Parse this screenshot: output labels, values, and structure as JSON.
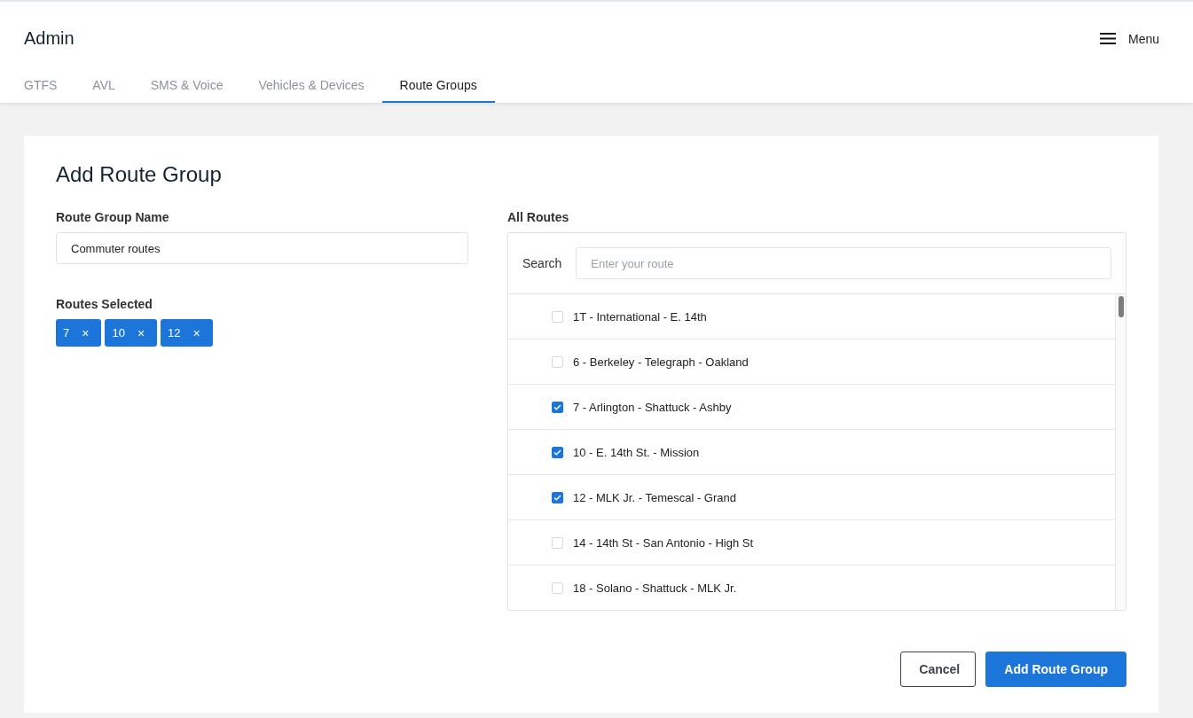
{
  "header": {
    "title": "Admin",
    "menu": {
      "label": "Menu"
    }
  },
  "tabs": [
    {
      "label": "GTFS",
      "selected": false
    },
    {
      "label": "AVL",
      "selected": false
    },
    {
      "label": "SMS & Voice",
      "selected": false
    },
    {
      "label": "Vehicles & Devices",
      "selected": false
    },
    {
      "label": "Route Groups",
      "selected": true
    }
  ],
  "form": {
    "title": "Add Route Group",
    "name_field": {
      "label": "Route Group Name",
      "value": "Commuter routes"
    },
    "selected_routes": {
      "label": "Routes Selected",
      "chips": [
        {
          "label": "7",
          "remove": "×"
        },
        {
          "label": "10",
          "remove": "×"
        },
        {
          "label": "12",
          "remove": "×"
        }
      ]
    },
    "all_routes": {
      "label": "All Routes",
      "search": {
        "label": "Search",
        "placeholder": "Enter your route"
      },
      "routes": [
        {
          "label": "1T - International - E. 14th",
          "checked": false
        },
        {
          "label": "6 - Berkeley - Telegraph - Oakland",
          "checked": false
        },
        {
          "label": "7 - Arlington - Shattuck - Ashby",
          "checked": true
        },
        {
          "label": "10 - E. 14th St. - Mission",
          "checked": true
        },
        {
          "label": "12 - MLK Jr. - Temescal - Grand",
          "checked": true
        },
        {
          "label": "14 - 14th St - San Antonio - High St",
          "checked": false
        },
        {
          "label": "18 - Solano - Shattuck - MLK Jr.",
          "checked": false
        }
      ]
    },
    "buttons": [
      {
        "kind": "secondary",
        "label": "Cancel"
      },
      {
        "kind": "primary",
        "label": "Add Route Group"
      }
    ]
  }
}
